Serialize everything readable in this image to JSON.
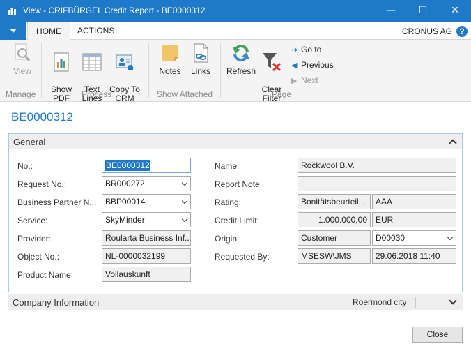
{
  "window": {
    "title": "View - CRIFBÜRGEL Credit Report - BE0000312",
    "minimize_glyph": "—",
    "maximize_glyph": "☐",
    "close_glyph": "✕"
  },
  "tabs": [
    {
      "label": "HOME"
    },
    {
      "label": "ACTIONS"
    }
  ],
  "company": "CRONUS AG",
  "help": "?",
  "ribbon": {
    "manage": {
      "label": "Manage",
      "view": "View"
    },
    "process": {
      "label": "Process",
      "show_pdf": "Show\nPDF",
      "text_lines": "Text\nLines",
      "copy_to_crm": "Copy To\nCRM"
    },
    "show_attached": {
      "label": "Show Attached",
      "notes": "Notes",
      "links": "Links"
    },
    "page": {
      "label": "Page",
      "refresh": "Refresh",
      "clear_filter": "Clear\nFilter",
      "go_to": "Go to",
      "previous": "Previous",
      "next": "Next"
    }
  },
  "page_title": "BE0000312",
  "general": {
    "header": "General",
    "fields": {
      "no_label": "No.:",
      "no_value": "BE0000312",
      "request_no_label": "Request No.:",
      "request_no_value": "BR000272",
      "bp_label": "Business Partner N...",
      "bp_value": "BBP00014",
      "service_label": "Service:",
      "service_value": "SkyMinder",
      "provider_label": "Provider:",
      "provider_value": "Roularta Business Inf...",
      "object_no_label": "Object No.:",
      "object_no_value": "NL-0000032199",
      "product_name_label": "Product Name:",
      "product_name_value": "Vollauskunft",
      "name_label": "Name:",
      "name_value": "Rockwool B.V.",
      "report_note_label": "Report Note:",
      "report_note_value": "",
      "rating_label": "Rating:",
      "rating_value": "Bonitätsbeurteil...",
      "rating_code": "AAA",
      "credit_limit_label": "Credit Limit:",
      "credit_limit_value": "1.000.000,00",
      "credit_limit_currency": "EUR",
      "origin_label": "Origin:",
      "origin_value": "Customer",
      "origin_code": "D00030",
      "requested_by_label": "Requested By:",
      "requested_by_value": "MSESW\\JMS",
      "requested_at": "29.06.2018 11:40"
    }
  },
  "company_information": {
    "header": "Company Information",
    "city": "Roermond city"
  },
  "close_button": "Close",
  "colors": {
    "accent": "#1f79c9"
  }
}
